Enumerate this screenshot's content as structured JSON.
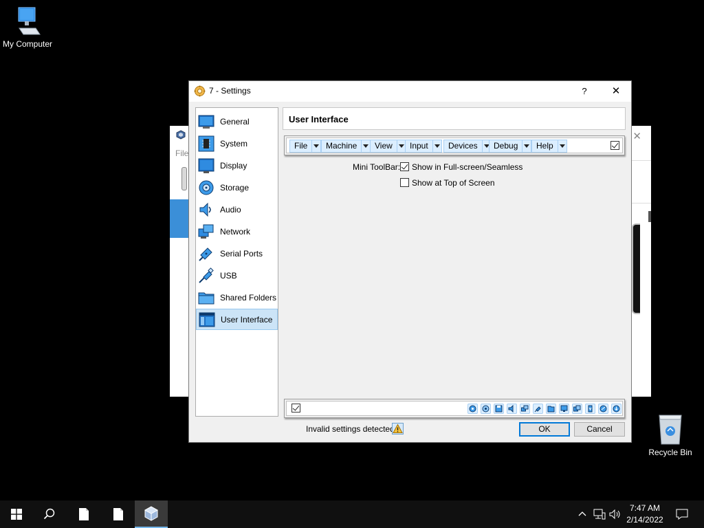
{
  "desktop": {
    "icons": [
      {
        "label": "My Computer",
        "icon": "computer-icon"
      },
      {
        "label": "Recycle Bin",
        "icon": "recycle-bin-icon"
      }
    ]
  },
  "background_window": {
    "menu_partial": "File"
  },
  "dialog": {
    "title": "7 - Settings",
    "help_label": "?",
    "close_label": "✕",
    "sidebar": {
      "items": [
        {
          "label": "General",
          "icon": "general-icon"
        },
        {
          "label": "System",
          "icon": "system-chip-icon"
        },
        {
          "label": "Display",
          "icon": "display-monitor-icon"
        },
        {
          "label": "Storage",
          "icon": "storage-disk-icon"
        },
        {
          "label": "Audio",
          "icon": "audio-speaker-icon"
        },
        {
          "label": "Network",
          "icon": "network-icon"
        },
        {
          "label": "Serial Ports",
          "icon": "serial-port-icon"
        },
        {
          "label": "USB",
          "icon": "usb-icon"
        },
        {
          "label": "Shared Folders",
          "icon": "shared-folder-icon"
        },
        {
          "label": "User Interface",
          "icon": "user-interface-icon"
        }
      ],
      "selected": "User Interface"
    },
    "section_title": "User Interface",
    "menubar_items": [
      {
        "label": "File"
      },
      {
        "label": "Machine"
      },
      {
        "label": "View"
      },
      {
        "label": "Input"
      },
      {
        "label": "Devices"
      },
      {
        "label": "Debug"
      },
      {
        "label": "Help"
      }
    ],
    "menubar_enabled": true,
    "mini_toolbar": {
      "label": "Mini ToolBar:",
      "options": [
        {
          "label": "Show in Full-screen/Seamless",
          "checked": true
        },
        {
          "label": "Show at Top of Screen",
          "checked": false
        }
      ]
    },
    "statusbar_enabled": true,
    "statusbar_icons": [
      "hard-disk-icon",
      "optical-disk-icon",
      "floppy-icon",
      "audio-icon",
      "network-icon",
      "usb-icon",
      "shared-folder-icon",
      "display-icon",
      "video-capture-icon",
      "cpu-icon",
      "mouse-integration-icon",
      "keyboard-icon"
    ],
    "invalid_settings_text": "Invalid settings detected",
    "ok_label": "OK",
    "cancel_label": "Cancel"
  },
  "taskbar": {
    "time": "7:47 AM",
    "date": "2/14/2022"
  },
  "colors": {
    "selection": "#cce4f7",
    "accent": "#0078d7",
    "menu_chip": "#dbeeff"
  }
}
